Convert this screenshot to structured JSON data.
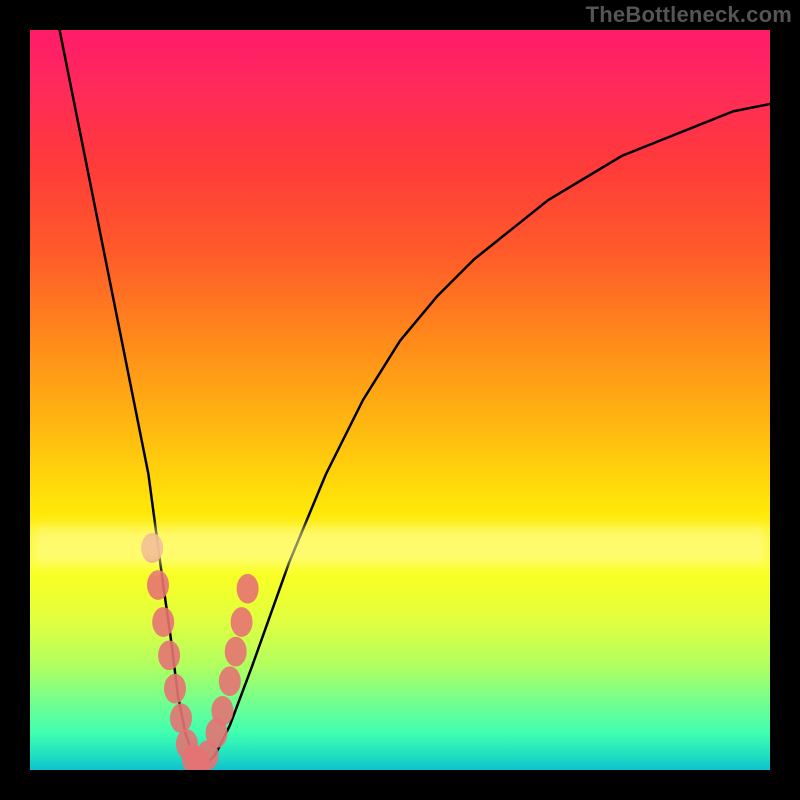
{
  "watermark": "TheBottleneck.com",
  "chart_data": {
    "type": "line",
    "title": "",
    "xlabel": "",
    "ylabel": "",
    "xlim": [
      0,
      100
    ],
    "ylim": [
      0,
      100
    ],
    "grid": false,
    "legend": false,
    "series": [
      {
        "name": "bottleneck-curve",
        "x": [
          4,
          6,
          8,
          10,
          12,
          14,
          16,
          18,
          19,
          20,
          21,
          22,
          23,
          24,
          25,
          27,
          30,
          35,
          40,
          45,
          50,
          55,
          60,
          65,
          70,
          75,
          80,
          85,
          90,
          95,
          100
        ],
        "y": [
          100,
          90,
          80,
          70,
          60,
          50,
          40,
          25,
          18,
          10,
          5,
          2,
          1,
          1,
          2,
          6,
          14,
          28,
          40,
          50,
          58,
          64,
          69,
          73,
          77,
          80,
          83,
          85,
          87,
          89,
          90
        ]
      }
    ],
    "markers": {
      "name": "gpu-points",
      "color": "#e57373",
      "radius": 11,
      "x": [
        16.5,
        17.3,
        18.0,
        18.8,
        19.6,
        20.4,
        21.2,
        22.0,
        22.8,
        24.0,
        25.2,
        26.0,
        27.0,
        27.8,
        28.6,
        29.4
      ],
      "y": [
        30.0,
        25.0,
        20.0,
        15.5,
        11.0,
        7.0,
        3.5,
        1.5,
        1.0,
        2.0,
        5.0,
        8.0,
        12.0,
        16.0,
        20.0,
        24.5
      ]
    },
    "gradient_stops": [
      {
        "pos": 0.0,
        "color": "#ff1b6b"
      },
      {
        "pos": 0.18,
        "color": "#ff3a3a"
      },
      {
        "pos": 0.42,
        "color": "#ff8a1a"
      },
      {
        "pos": 0.65,
        "color": "#ffe808"
      },
      {
        "pos": 0.86,
        "color": "#b0ff60"
      },
      {
        "pos": 1.0,
        "color": "#10c0d0"
      }
    ],
    "highlight_band_y": [
      67,
      72
    ]
  }
}
